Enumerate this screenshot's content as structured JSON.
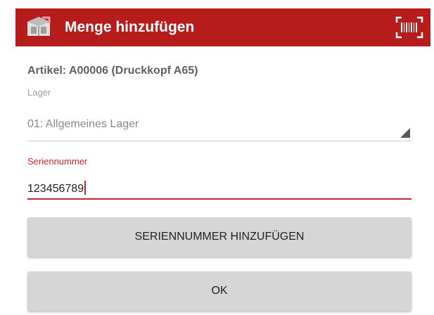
{
  "appbar": {
    "title": "Menge hinzufügen",
    "app_icon": "warehouse-box-icon",
    "scan_icon": "barcode-scan-icon",
    "color": "#b71c1c"
  },
  "form": {
    "article_text": "Artikel: A00006 (Druckkopf A65)",
    "lager_label": "Lager",
    "lager_value": "01: Allgemeines Lager",
    "serial_label": "Seriennummer",
    "serial_value": "123456789",
    "accent_color": "#c62828"
  },
  "buttons": {
    "add_serial": "SERIENNUMMER HINZUFÜGEN",
    "ok": "OK"
  }
}
